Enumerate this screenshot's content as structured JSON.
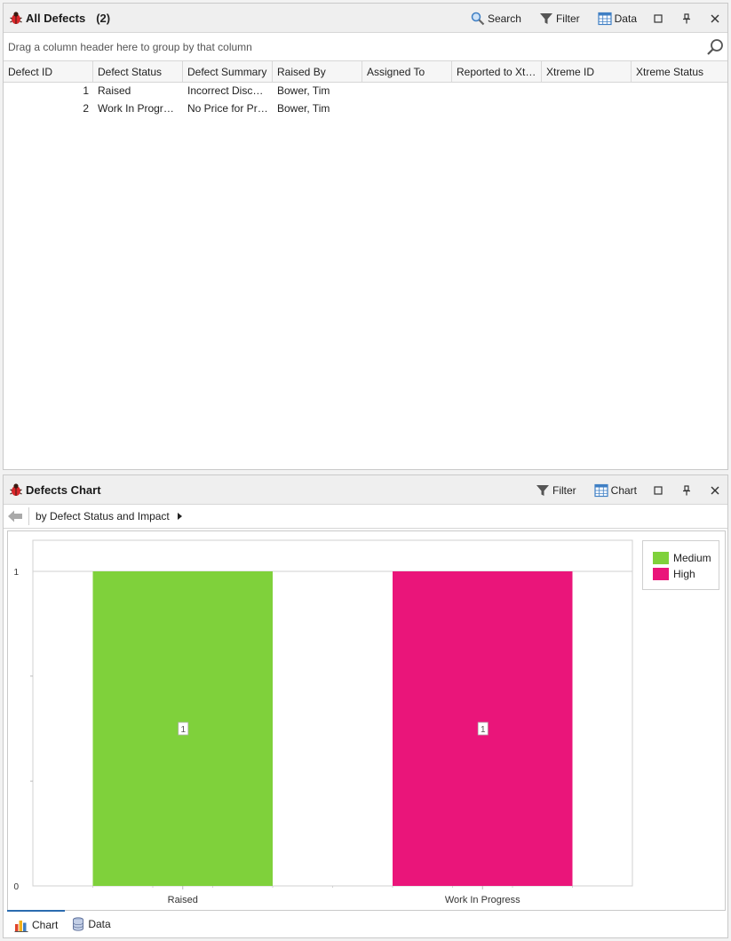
{
  "defects_panel": {
    "title": "All Defects",
    "count": "(2)",
    "toolbar": {
      "search": "Search",
      "filter": "Filter",
      "data": "Data"
    },
    "group_hint": "Drag a column header here to group by that column",
    "columns": [
      "Defect ID",
      "Defect Status",
      "Defect Summary",
      "Raised By",
      "Assigned To",
      "Reported to Xtr…",
      "Xtreme ID",
      "Xtreme Status"
    ],
    "rows": [
      [
        "1",
        "Raised",
        "Incorrect Discou…",
        "Bower, Tim",
        "",
        "",
        "",
        ""
      ],
      [
        "2",
        "Work In Progress",
        "No Price for Prod…",
        "Bower, Tim",
        "",
        "",
        "",
        ""
      ]
    ]
  },
  "chart_panel": {
    "title": "Defects Chart",
    "toolbar": {
      "filter": "Filter",
      "chart": "Chart"
    },
    "breadcrumb": "by Defect Status and Impact",
    "tabs": {
      "chart": "Chart",
      "data": "Data"
    }
  },
  "chart_data": {
    "type": "bar",
    "categories": [
      "Raised",
      "Work In Progress"
    ],
    "series": [
      {
        "name": "Medium",
        "values": [
          1,
          0
        ],
        "color": "#7fd13b"
      },
      {
        "name": "High",
        "values": [
          0,
          1
        ],
        "color": "#ea157a"
      }
    ],
    "ylim": [
      0,
      1
    ],
    "yticks": [
      "0",
      "1"
    ],
    "data_labels": [
      "1",
      "1"
    ],
    "legend_position": "top-right",
    "grid": true
  },
  "colors": {
    "medium": "#7fd13b",
    "high": "#ea157a",
    "icon_red": "#d9262a"
  }
}
